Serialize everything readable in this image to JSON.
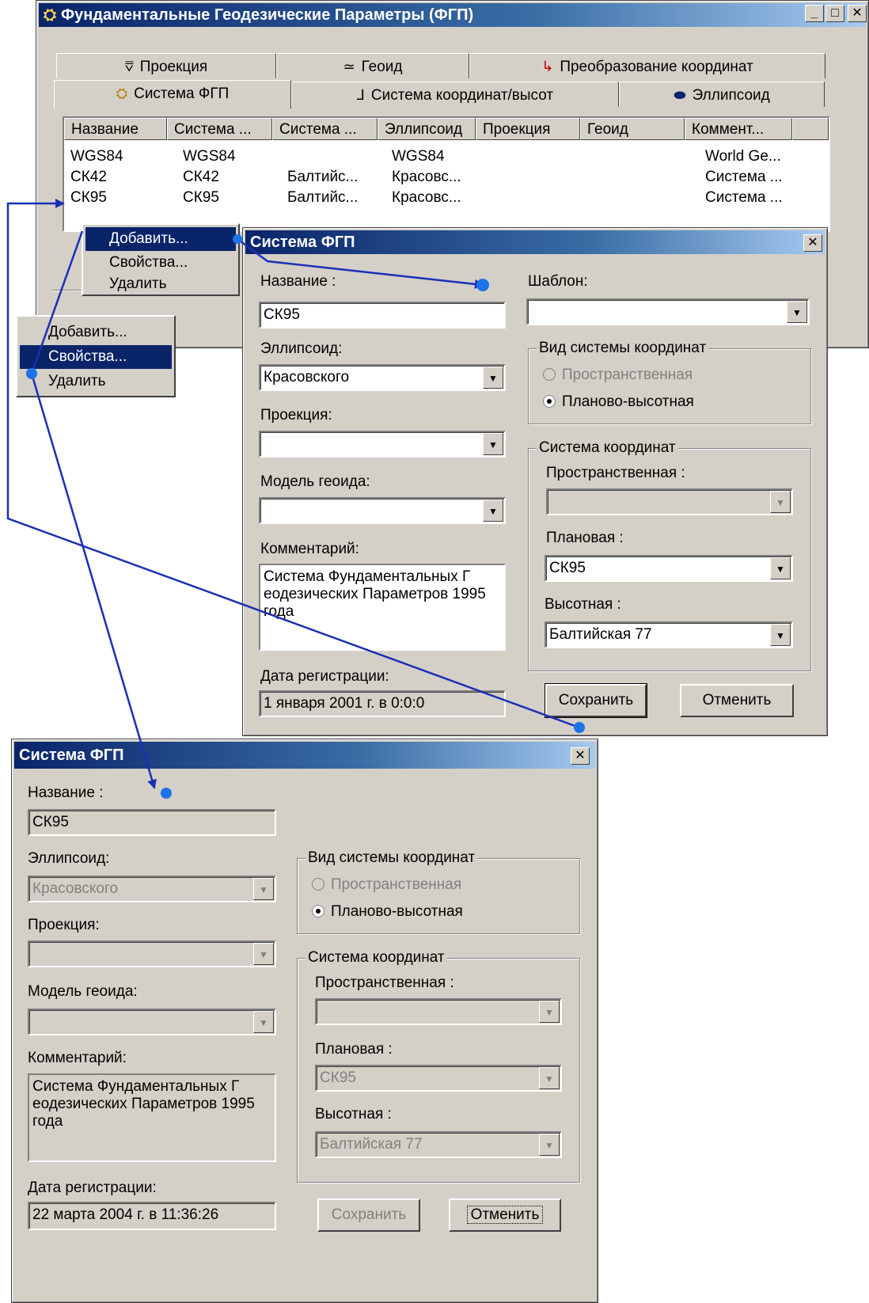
{
  "main_window": {
    "title": "Фундаментальные Геодезические Параметры (ФГП)",
    "tabs_row1": [
      "Проекция",
      "Геоид",
      "Преобразование координат"
    ],
    "tabs_row2": [
      "Система ФГП",
      "Система координат/высот",
      "Эллипсоид"
    ],
    "columns": [
      "Название",
      "Система ...",
      "Система ...",
      "Эллипсоид",
      "Проекция",
      "Геоид",
      "Коммент..."
    ],
    "rows": [
      [
        "WGS84",
        "WGS84",
        "",
        "WGS84",
        "",
        "",
        "World Ge..."
      ],
      [
        "СК42",
        "СК42",
        "Балтийс...",
        "Красовс...",
        "",
        "",
        "Система ..."
      ],
      [
        "СК95",
        "СК95",
        "Балтийс...",
        "Красовс...",
        "",
        "",
        "Система ..."
      ]
    ]
  },
  "context_menu_1": {
    "items": [
      "Добавить...",
      "Свойства...",
      "Удалить"
    ]
  },
  "context_menu_2": {
    "items": [
      "Добавить...",
      "Свойства...",
      "Удалить"
    ]
  },
  "dialog_edit": {
    "title": "Система ФГП",
    "name_label": "Название :",
    "name_value": "СК95",
    "template_label": "Шаблон:",
    "template_value": "",
    "ellipsoid_label": "Эллипсоид:",
    "ellipsoid_value": "Красовского",
    "projection_label": "Проекция:",
    "projection_value": "",
    "geoid_label": "Модель геоида:",
    "geoid_value": "",
    "comment_label": "Комментарий:",
    "comment_value": "Система Фундаментальных Г еодезических Параметров 1995 года",
    "date_label": "Дата регистрации:",
    "date_value": "1 января 2001 г.  в 0:0:0",
    "kind_group": "Вид системы координат",
    "radio_spatial": "Пространственная",
    "radio_planar": "Планово-высотная",
    "cs_group": "Система координат",
    "spatial_label": "Пространственная :",
    "spatial_value": "",
    "planar_label": "Плановая :",
    "planar_value": "СК95",
    "height_label": "Высотная :",
    "height_value": "Балтийская 77",
    "save": "Сохранить",
    "cancel": "Отменить"
  },
  "dialog_view": {
    "title": "Система ФГП",
    "name_label": "Название :",
    "name_value": "СК95",
    "ellipsoid_label": "Эллипсоид:",
    "ellipsoid_value": "Красовского",
    "projection_label": "Проекция:",
    "projection_value": "",
    "geoid_label": "Модель геоида:",
    "geoid_value": "",
    "comment_label": "Комментарий:",
    "comment_value": "Система Фундаментальных Г еодезических Параметров 1995 года",
    "date_label": "Дата регистрации:",
    "date_value": "22 марта 2004 г.  в 11:36:26",
    "kind_group": "Вид системы координат",
    "radio_spatial": "Пространственная",
    "radio_planar": "Планово-высотная",
    "cs_group": "Система координат",
    "spatial_label": "Пространственная :",
    "spatial_value": "",
    "planar_label": "Плановая :",
    "planar_value": "СК95",
    "height_label": "Высотная :",
    "height_value": "Балтийская 77",
    "save": "Сохранить",
    "cancel": "Отменить"
  },
  "colors": {
    "titlebar": "#0a246a",
    "face": "#d4d0c8",
    "arrow": "#1a2fb5",
    "dot": "#1e73e8"
  }
}
